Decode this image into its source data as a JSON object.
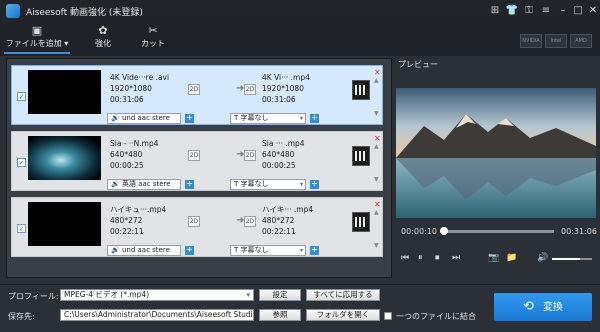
{
  "app": {
    "title": "Aiseesoft 動画強化 (未登録)",
    "window_buttons": [
      "⊞",
      "👕",
      "⚿",
      "≡",
      "–",
      "□",
      "✕"
    ]
  },
  "toolbar": {
    "add_label": "ファイルを追加",
    "add_arrow": "▾",
    "enhance_label": "強化",
    "cut_label": "カット",
    "gpu_badges": [
      "NVIDIA",
      "Intel",
      "AMD"
    ]
  },
  "files": [
    {
      "src_name": "4K Vide···re .avi",
      "src_res": "1920*1080",
      "src_dur": "00:31:06",
      "dst_name": "4K Vi··· .mp4",
      "dst_res": "1920*1080",
      "dst_dur": "00:31:06",
      "badge": "2D",
      "audio": "und aac stere",
      "subtitle": "字幕なし",
      "checked": true,
      "selected": true
    },
    {
      "src_name": "Sia - ··N.mp4",
      "src_res": "640*480",
      "src_dur": "00:00:25",
      "dst_name": "Sia ··· .mp4",
      "dst_res": "640*480",
      "dst_dur": "00:00:25",
      "badge": "2D",
      "audio": "英語 aac stere",
      "subtitle": "字幕なし",
      "checked": true,
      "selected": false
    },
    {
      "src_name": "ハイキュ···.mp4",
      "src_res": "480*272",
      "src_dur": "00:22:11",
      "dst_name": "ハイキ··· .mp4",
      "dst_res": "480*272",
      "dst_dur": "00:22:11",
      "badge": "2D",
      "audio": "und aac stere",
      "subtitle": "字幕なし",
      "checked": true,
      "selected": false
    }
  ],
  "row_icons": {
    "check": "✓",
    "arrow": "➜",
    "remove": "✕",
    "up": "▲",
    "down": "▼",
    "plus": "+",
    "dropdown": "▾",
    "audio_prefix": "🔊",
    "subtitle_prefix": "T"
  },
  "preview": {
    "label": "プレビュー",
    "time_current": "00:00:10",
    "time_total": "00:31:06",
    "progress": 0.005,
    "volume": 0.7,
    "controls": [
      "⏮",
      "⏸",
      "⏹",
      "⏭",
      "📷",
      "📁",
      "🔊"
    ]
  },
  "bottom": {
    "profile_label": "プロフィール:",
    "profile_value": "MPEG-4 ビデオ (*.mp4)",
    "settings_button": "設定",
    "apply_all_button": "すべてに応用する",
    "dest_label": "保存先:",
    "dest_value": "C:\\Users\\Administrator\\Documents\\Aiseesoft Studio",
    "browse_button": "参照",
    "open_folder_button": "フォルダを開く",
    "merge_label": "一つのファイルに結合",
    "convert_button": "変換",
    "convert_icon": "⟲"
  }
}
